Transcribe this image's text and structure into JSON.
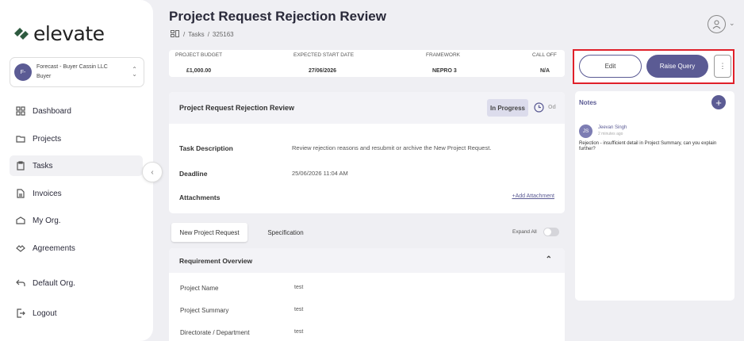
{
  "app": {
    "logo_text": "elevate"
  },
  "org": {
    "initials": "F-",
    "name": "Forecast - Buyer Cassin LLC",
    "role": "Buyer"
  },
  "nav": [
    {
      "label": "Dashboard",
      "icon": "dashboard-icon"
    },
    {
      "label": "Projects",
      "icon": "folder-icon"
    },
    {
      "label": "Tasks",
      "icon": "clipboard-icon",
      "active": true
    },
    {
      "label": "Invoices",
      "icon": "file-icon"
    },
    {
      "label": "My Org.",
      "icon": "building-icon"
    },
    {
      "label": "Agreements",
      "icon": "handshake-icon"
    }
  ],
  "footer_nav": [
    {
      "label": "Default Org.",
      "icon": "back-arrow-icon"
    },
    {
      "label": "Logout",
      "icon": "logout-icon"
    }
  ],
  "page": {
    "title": "Project Request Rejection Review",
    "breadcrumb": [
      "Tasks",
      "325163"
    ]
  },
  "budget": {
    "columns": [
      {
        "label": "PROJECT BUDGET",
        "value": "£1,000.00"
      },
      {
        "label": "EXPECTED START DATE",
        "value": "27/06/2026"
      },
      {
        "label": "FRAMEWORK",
        "value": "NEPRO 3"
      },
      {
        "label": "CALL OFF",
        "value": "N/A"
      }
    ]
  },
  "actions": {
    "edit": "Edit",
    "raise_query": "Raise Query",
    "more": "⋮"
  },
  "task": {
    "header": "Project Request Rejection Review",
    "status": "In Progress",
    "overdue": "Od",
    "rows": [
      {
        "label": "Task Description",
        "value": "Review rejection reasons and resubmit or archive the New Project Request."
      },
      {
        "label": "Deadline",
        "value": "25/06/2026 11:04 AM"
      },
      {
        "label": "Attachments",
        "value": ""
      }
    ],
    "add_attachment": "+Add Attachment"
  },
  "tabs": [
    {
      "label": "New Project Request",
      "active": true
    },
    {
      "label": "Specification",
      "active": false
    }
  ],
  "expand_all": "Expand All",
  "requirement": {
    "header": "Requirement Overview",
    "rows": [
      {
        "label": "Project Name",
        "value": "test"
      },
      {
        "label": "Project Summary",
        "value": "test"
      },
      {
        "label": "Directorate / Department",
        "value": "test"
      }
    ]
  },
  "notes": {
    "title": "Notes",
    "items": [
      {
        "initials": "JS",
        "author": "Jeevan Singh",
        "time": "2 minutes ago",
        "text": "Rejection - insufficient detail in Project Summary, can you explain further?"
      }
    ]
  },
  "colors": {
    "accent": "#5b5b94",
    "highlight_border": "#e0202a"
  }
}
